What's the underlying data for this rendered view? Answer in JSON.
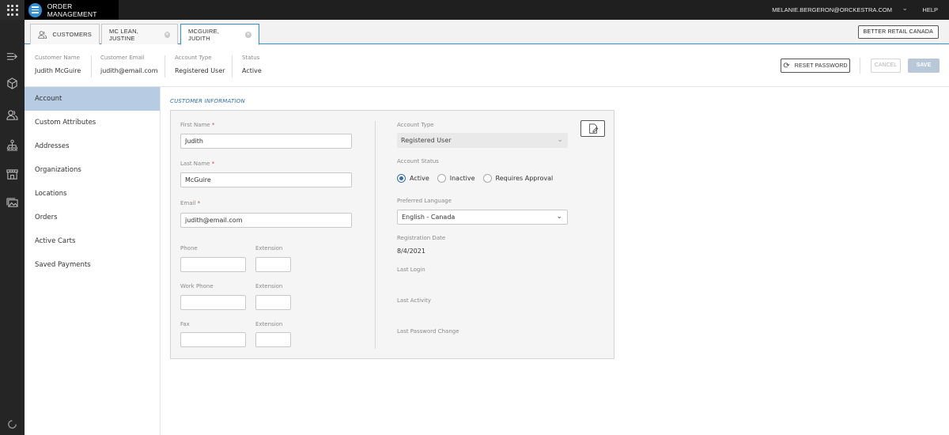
{
  "topbar": {
    "app_name": "ORDER MANAGEMENT",
    "user_email": "MELANIE.BERGERON@ORCKESTRA.COM",
    "help": "HELP"
  },
  "rail": {
    "icons": [
      "swap-arrows-icon",
      "cube-icon",
      "customers-icon",
      "org-chart-icon",
      "store-icon",
      "images-icon"
    ],
    "bottom_icon": "spinner-icon"
  },
  "tabs": [
    {
      "label": "CUSTOMERS",
      "icon": "customers-icon",
      "closable": false,
      "active": false
    },
    {
      "label": "MC LEAN, JUSTINE",
      "closable": true,
      "active": false
    },
    {
      "label": "MCGUIRE, JUDITH",
      "closable": true,
      "active": true
    }
  ],
  "scope_button": "BETTER RETAIL CANADA",
  "customer_header": {
    "name_label": "Customer Name",
    "name_value": "Judith McGuire",
    "email_label": "Customer Email",
    "email_value": "judith@email.com",
    "type_label": "Account Type",
    "type_value": "Registered User",
    "status_label": "Status",
    "status_value": "Active",
    "reset_password": "RESET PASSWORD",
    "cancel": "CANCEL",
    "save": "SAVE"
  },
  "sidenav": {
    "items": [
      "Account",
      "Custom Attributes",
      "Addresses",
      "Organizations",
      "Locations",
      "Orders",
      "Active Carts",
      "Saved Payments"
    ],
    "active_index": 0
  },
  "form": {
    "section_title": "CUSTOMER INFORMATION",
    "first_name_label": "First Name",
    "first_name_value": "Judith",
    "last_name_label": "Last Name",
    "last_name_value": "McGuire",
    "email_label": "Email",
    "email_value": "judith@email.com",
    "required_mark": "*",
    "phone_label": "Phone",
    "phone_value": "",
    "extension_label": "Extension",
    "phone_ext_value": "",
    "work_phone_label": "Work Phone",
    "work_phone_value": "",
    "work_ext_value": "",
    "fax_label": "Fax",
    "fax_value": "",
    "fax_ext_value": "",
    "account_type_label": "Account Type",
    "account_type_value": "Registered User",
    "account_status_label": "Account Status",
    "status_options": [
      "Active",
      "Inactive",
      "Requires Approval"
    ],
    "status_selected": "Active",
    "preferred_language_label": "Preferred Language",
    "preferred_language_value": "English - Canada",
    "registration_date_label": "Registration Date",
    "registration_date_value": "8/4/2021",
    "last_login_label": "Last Login",
    "last_activity_label": "Last Activity",
    "last_password_change_label": "Last Password Change"
  },
  "colors": {
    "accent": "#2f8fd8",
    "nav_active": "#b7cce2",
    "section_title": "#2f6fad",
    "required": "#d9453f"
  }
}
